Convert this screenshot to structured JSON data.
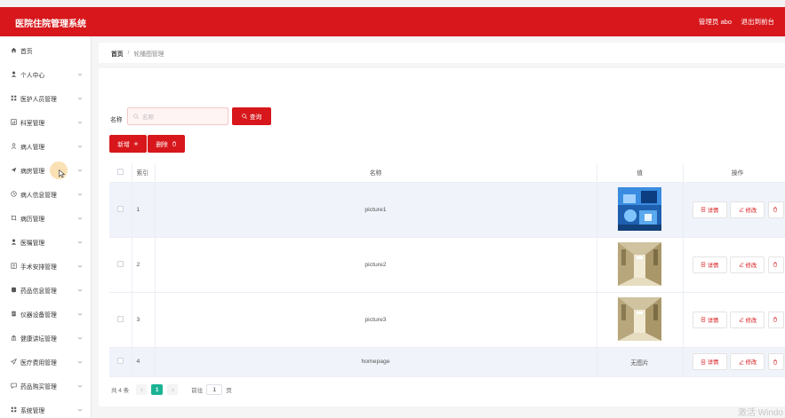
{
  "header": {
    "title": "医院住院管理系统",
    "admin": "管理员 abo",
    "logout": "退出到前台"
  },
  "sidebar": {
    "items": [
      {
        "label": "首页",
        "icon": "home-icon"
      },
      {
        "label": "个人中心",
        "icon": "user-icon"
      },
      {
        "label": "医护人员管理",
        "icon": "grid-icon"
      },
      {
        "label": "科室管理",
        "icon": "chart-icon"
      },
      {
        "label": "病人管理",
        "icon": "person-outline-icon"
      },
      {
        "label": "病房管理",
        "icon": "paper-plane-icon"
      },
      {
        "label": "病人信息管理",
        "icon": "clock-icon"
      },
      {
        "label": "病历管理",
        "icon": "crop-icon"
      },
      {
        "label": "医嘱管理",
        "icon": "user-icon"
      },
      {
        "label": "手术安排管理",
        "icon": "list-icon"
      },
      {
        "label": "药品信息管理",
        "icon": "database-icon"
      },
      {
        "label": "仪器设备管理",
        "icon": "document-icon"
      },
      {
        "label": "健康讲坛管理",
        "icon": "bank-icon"
      },
      {
        "label": "医疗费用管理",
        "icon": "send-icon"
      },
      {
        "label": "药品购买管理",
        "icon": "chat-icon"
      },
      {
        "label": "系统管理",
        "icon": "grid-icon"
      }
    ]
  },
  "breadcrumb": {
    "home": "首页",
    "sep": "/",
    "current": "轮播图管理"
  },
  "search": {
    "label": "名称",
    "placeholder": "名称",
    "button": "查询"
  },
  "actions": {
    "add": "新增",
    "delete": "删除"
  },
  "table": {
    "headers": {
      "index": "索引",
      "name": "名称",
      "value": "值",
      "ops": "操作"
    },
    "rows": [
      {
        "index": "1",
        "name": "picture1",
        "value": "",
        "thumb": "blue"
      },
      {
        "index": "2",
        "name": "picture2",
        "value": "",
        "thumb": "corridor"
      },
      {
        "index": "3",
        "name": "picture3",
        "value": "",
        "thumb": "corridor"
      },
      {
        "index": "4",
        "name": "homepage",
        "value": "无图片",
        "thumb": "none"
      }
    ],
    "op_labels": {
      "detail": "详情",
      "edit": "修改"
    }
  },
  "pager": {
    "total": "共 4 条",
    "current": "1",
    "goto": "前往",
    "goto_value": "1",
    "page_suffix": "页"
  },
  "watermark": "激活 Windo",
  "colors": {
    "brand": "#d7171b",
    "pager_active": "#1ab394"
  }
}
